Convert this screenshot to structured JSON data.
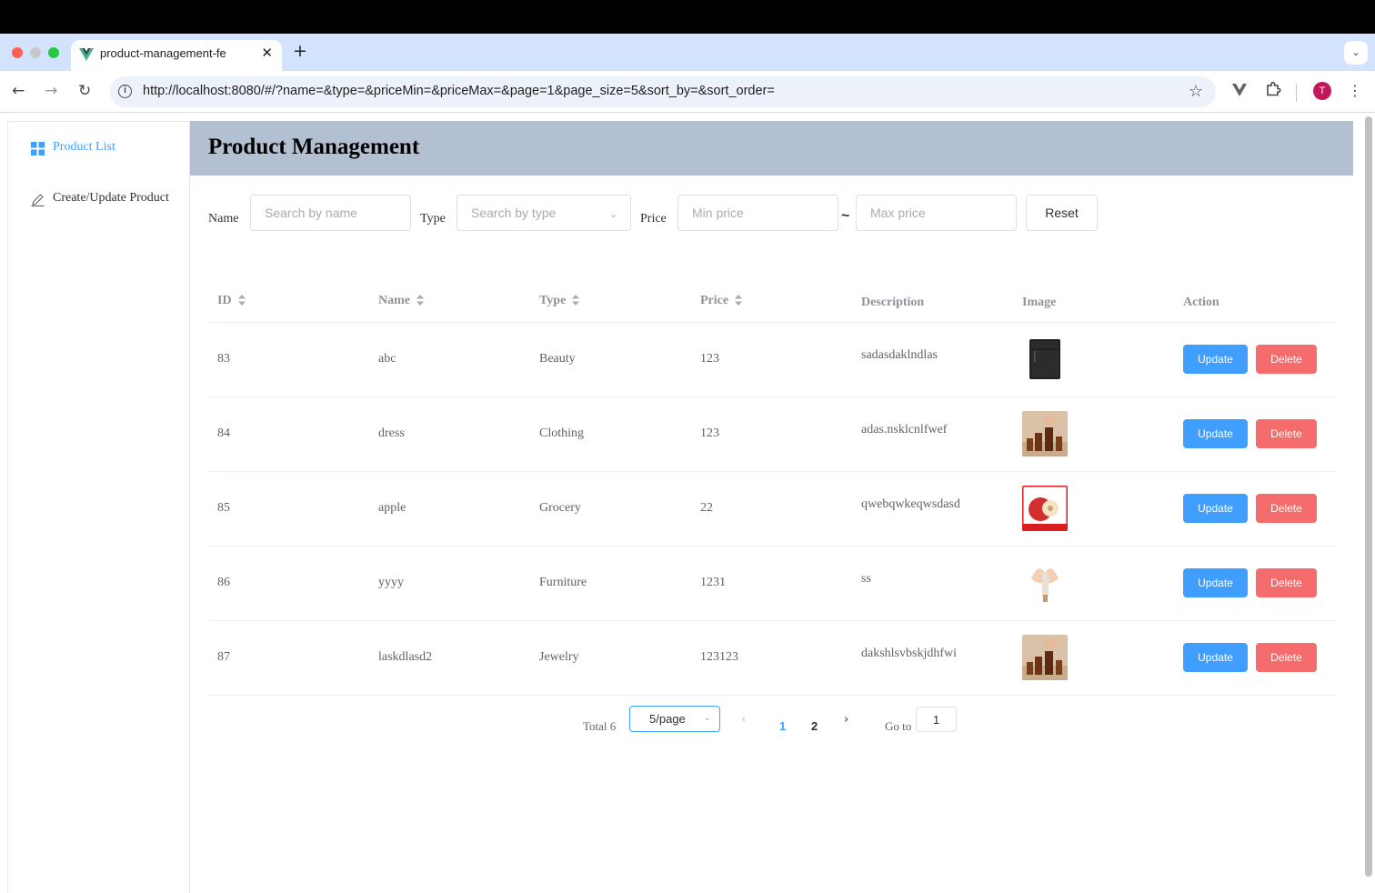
{
  "browser": {
    "tab_title": "product-management-fe",
    "url": "http://localhost:8080/#/?name=&type=&priceMin=&priceMax=&page=1&page_size=5&sort_by=&sort_order=",
    "avatar_letter": "T",
    "close_glyph": "✕",
    "new_tab_glyph": "+",
    "tab_search_glyph": "⌄",
    "back_glyph": "←",
    "forward_glyph": "→",
    "reload_glyph": "↻",
    "star_glyph": "☆",
    "info_glyph": "i",
    "menu_glyph": "⋮"
  },
  "sidebar": {
    "items": [
      {
        "label": "Product List",
        "icon": "grid-icon",
        "active": true
      },
      {
        "label": "Create/Update Product",
        "icon": "edit-icon",
        "active": false
      }
    ]
  },
  "header": {
    "title": "Product Management"
  },
  "filters": {
    "name_label": "Name",
    "name_placeholder": "Search by name",
    "type_label": "Type",
    "type_placeholder": "Search by type",
    "price_label": "Price",
    "min_placeholder": "Min price",
    "separator": "~",
    "max_placeholder": "Max price",
    "reset_label": "Reset"
  },
  "table": {
    "columns": [
      "ID",
      "Name",
      "Type",
      "Price",
      "Description",
      "Image",
      "Action"
    ],
    "rows": [
      {
        "id": "83",
        "name": "abc",
        "type": "Beauty",
        "price": "123",
        "description": "sadasdaklndlas",
        "image": "refrigerator"
      },
      {
        "id": "84",
        "name": "dress",
        "type": "Clothing",
        "price": "123",
        "description": "adas.nsklcnlfwef",
        "image": "bottles"
      },
      {
        "id": "85",
        "name": "apple",
        "type": "Grocery",
        "price": "22",
        "description": "qwebqwkeqwsdasd",
        "image": "apple"
      },
      {
        "id": "86",
        "name": "yyyy",
        "type": "Furniture",
        "price": "1231",
        "description": "ss",
        "image": "cosmetic"
      },
      {
        "id": "87",
        "name": "laskdlasd2",
        "type": "Jewelry",
        "price": "123123",
        "description": "dakshlsvbskjdhfwi",
        "image": "bottles"
      }
    ],
    "update_label": "Update",
    "delete_label": "Delete"
  },
  "pagination": {
    "total_label": "Total 6",
    "page_size": "5/page",
    "pages": [
      "1",
      "2"
    ],
    "current_page": "1",
    "prev_glyph": "‹",
    "next_glyph": "›",
    "goto_label": "Go to",
    "goto_value": "1"
  },
  "colors": {
    "primary": "#409eff",
    "danger": "#f56c6c",
    "header_bg": "#b3c0d1",
    "tab_strip": "#d3e3fd"
  }
}
